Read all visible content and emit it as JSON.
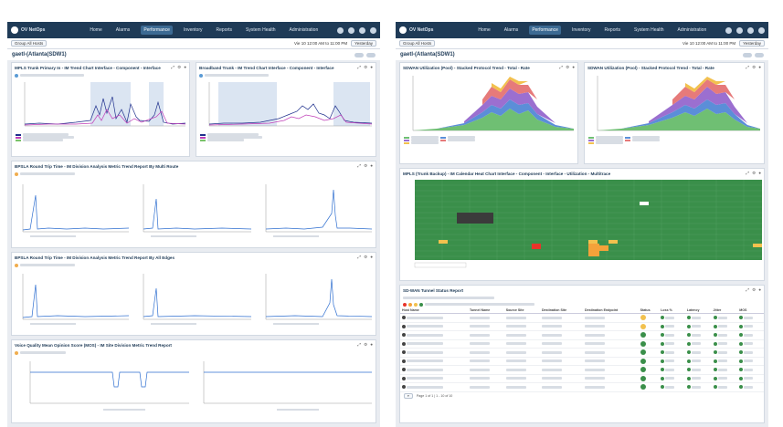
{
  "left": {
    "app_name": "OV NetOps",
    "nav": [
      "Home",
      "Alarms",
      "Performance",
      "Inventory",
      "Reports",
      "System Health",
      "Administration"
    ],
    "active_nav": "Performance",
    "group_selector": "Group All Hosts",
    "timestamp": "Vie 10 12:00 AM  to  11:00 PM",
    "range": "Yesterday",
    "page_title": "gaetl-(Atlanta(SDW1)",
    "panels": [
      {
        "title": "MPLS Trunk Primary In - IM Trend Chart Interface - Component - Interface"
      },
      {
        "title": "Broadband Trunk - IM Trend Chart Interface - Component - Interface"
      },
      {
        "title": "BPSLA Round Trip Time - IM Division Analysis Metric Trend Report By Multi Route"
      },
      {
        "title": "BPSLA Round Trip Time - IM Division Analysis Metric Trend Report By All Edges"
      },
      {
        "title": "Voice Quality Mean Opinion Score (MOS) - IM Site Division Metric Trend Report"
      }
    ]
  },
  "right": {
    "app_name": "OV NetOps",
    "nav": [
      "Home",
      "Alarms",
      "Performance",
      "Inventory",
      "Reports",
      "System Health",
      "Administration"
    ],
    "active_nav": "Performance",
    "group_selector": "Group All Hosts",
    "timestamp": "Vie 10 12:00 AM  to  11:00 PM",
    "range": "Yesterday",
    "page_title": "gaetl-(Atlanta(SDW1)",
    "panels": [
      {
        "title": "SDWAN Utilization (Pool) - Stacked Protocol Trend - Total - Rate"
      },
      {
        "title": "SDWAN Utilization (Pool) - Stacked Protocol Trend - Total - Rate"
      },
      {
        "title": "MPLS (Trunk Backup) - IM Calendar Heat Chart Interface - Component - Interface - Utilization - Multitrace"
      },
      {
        "title": "SD-WAN Tunnel Status Report"
      }
    ],
    "table_headers": [
      "Host Name",
      "Tunnel Name",
      "Source Site",
      "Destination Site",
      "Destination Endpoint",
      "Status",
      "Loss %",
      "Latency",
      "Jitter",
      "MOS"
    ],
    "pager": "Page 1 of 1  |  1 - 10 of 10"
  }
}
